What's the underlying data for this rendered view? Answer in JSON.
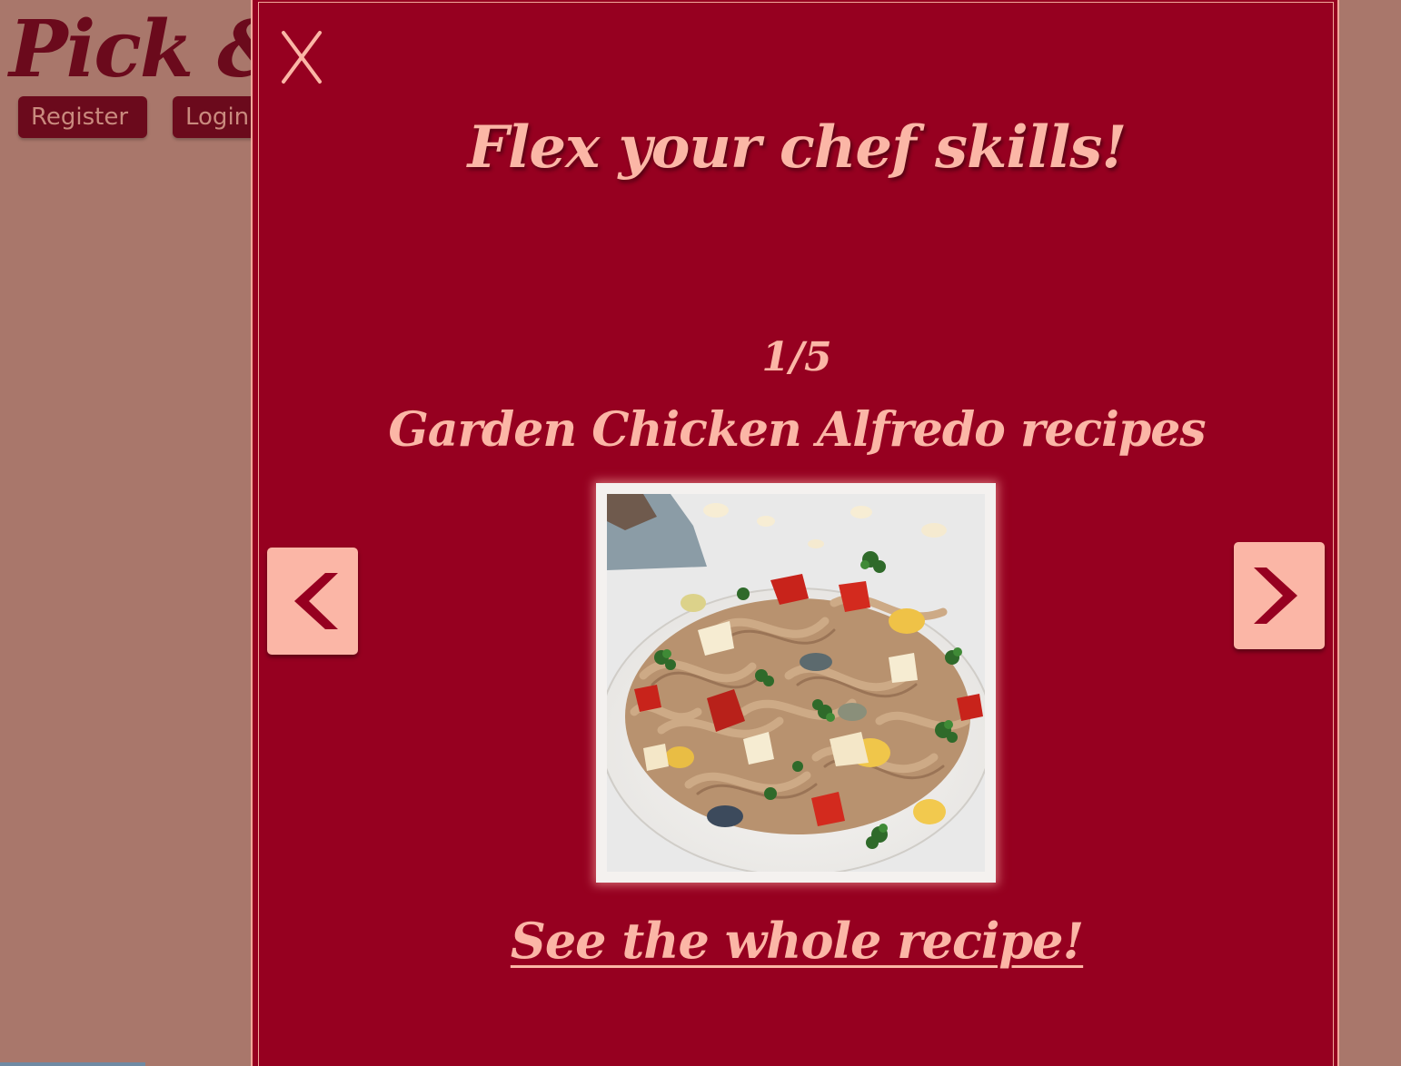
{
  "site": {
    "logo_text": "Pick &",
    "nav": {
      "register_label": "Register",
      "login_label": "Login"
    }
  },
  "modal": {
    "close_icon": "close-x-icon",
    "title": "Flex your chef skills!",
    "counter": "1/5",
    "recipe_name": "Garden Chicken Alfredo recipes",
    "photo_subject": "pasta-dish-image",
    "prev_icon": "chevron-left-icon",
    "next_icon": "chevron-right-icon",
    "link_label": "See the whole recipe!"
  },
  "colors": {
    "page_dimmed": "#a9776b",
    "modal_background": "#960020",
    "accent_pink": "#fbb6a6",
    "nav_button": "#6b0a1c"
  }
}
